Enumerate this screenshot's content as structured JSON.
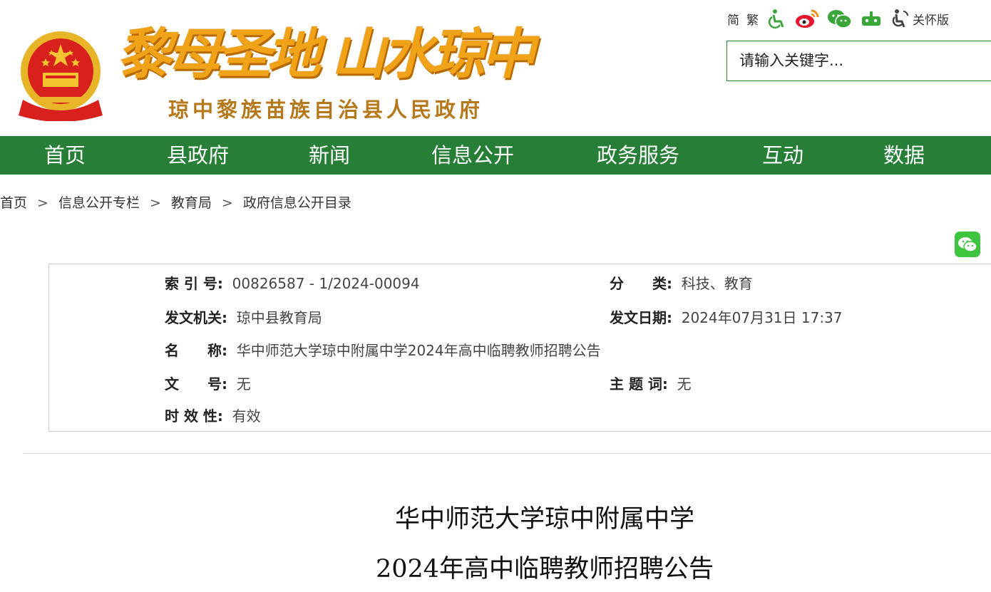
{
  "header": {
    "site_title": "黎母圣地 山水琼中",
    "site_subtitle": "琼中黎族苗族自治县人民政府",
    "toolbar": {
      "simplified": "简",
      "traditional": "繁",
      "care_mode": "关怀版",
      "icons": [
        "accessibility-icon",
        "weibo-icon",
        "wechat-icon",
        "robot-icon",
        "elderly-care-icon"
      ]
    },
    "search": {
      "placeholder": "请输入关键字..."
    }
  },
  "nav": {
    "items": [
      "首页",
      "县政府",
      "新闻",
      "信息公开",
      "政务服务",
      "互动",
      "数据"
    ]
  },
  "breadcrumb": {
    "items": [
      "首页",
      "信息公开专栏",
      "教育局",
      "政府信息公开目录"
    ],
    "separator": ">"
  },
  "meta": {
    "index_label": "索 引 号:",
    "index_value": "00826587 - 1/2024-00094",
    "category_label": "分　　类:",
    "category_value": "科技、教育",
    "issuer_label": "发文机关:",
    "issuer_value": "琼中县教育局",
    "date_label": "发文日期:",
    "date_value": "2024年07月31日 17:37",
    "name_label": "名　　称:",
    "name_value": "华中师范大学琼中附属中学2024年高中临聘教师招聘公告",
    "docno_label": "文　　号:",
    "docno_value": "无",
    "keywords_label": "主 题 词:",
    "keywords_value": "无",
    "validity_label": "时 效 性:",
    "validity_value": "有效"
  },
  "document": {
    "title_line1": "华中师范大学琼中附属中学",
    "title_line2": "2024年高中临聘教师招聘公告"
  },
  "colors": {
    "nav_green": "#267e37",
    "title_orange": "#f0a319",
    "subtitle_brown": "#b5781b"
  }
}
